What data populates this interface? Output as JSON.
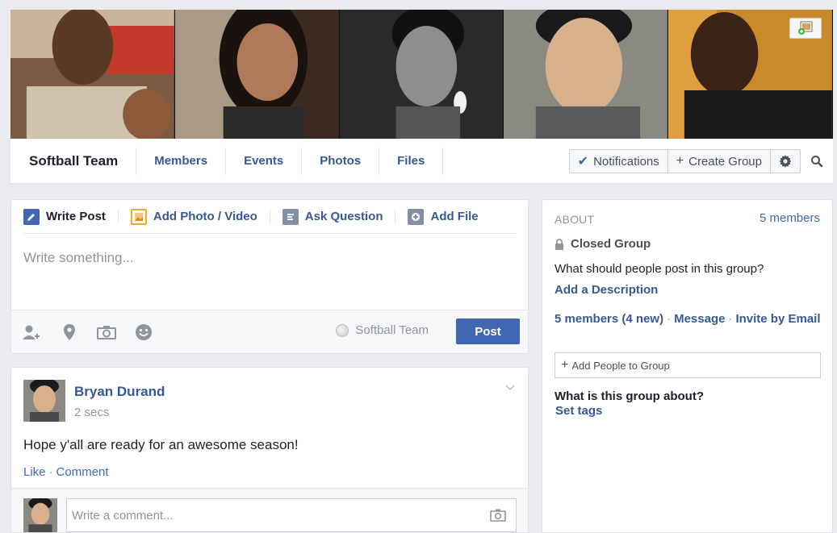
{
  "group": {
    "name": "Softball Team",
    "nav_links": [
      "Members",
      "Events",
      "Photos",
      "Files"
    ],
    "notifications_label": "Notifications",
    "create_group_label": "Create Group"
  },
  "composer": {
    "tabs": [
      {
        "label": "Write Post",
        "icon": "pencil-icon",
        "color": "#4267b2"
      },
      {
        "label": "Add Photo / Video",
        "icon": "photo-icon",
        "color": "#f5a623"
      },
      {
        "label": "Ask Question",
        "icon": "question-icon",
        "color": "#7f8fa6"
      },
      {
        "label": "Add File",
        "icon": "file-icon",
        "color": "#7f8fa6"
      }
    ],
    "placeholder": "Write something...",
    "footer_icons": [
      "tag-friends-icon",
      "location-icon",
      "camera-icon",
      "feeling-icon"
    ],
    "audience": "Softball Team",
    "post_label": "Post"
  },
  "story": {
    "author": "Bryan Durand",
    "time": "2 secs",
    "text": "Hope y'all are ready for an awesome season!",
    "like_label": "Like",
    "comment_label": "Comment",
    "comment_placeholder": "Write a comment..."
  },
  "about": {
    "title": "ABOUT",
    "member_count": "5 members",
    "privacy": "Closed Group",
    "description_prompt": "What should people post in this group?",
    "add_description": "Add a Description",
    "members_link": "5 members",
    "members_new": "(4 new)",
    "message_link": "Message",
    "invite_link": "Invite by Email",
    "add_people_placeholder": "Add People to Group",
    "about_question": "What is this group about?",
    "set_tags": "Set tags"
  },
  "colors": {
    "brand_blue": "#4267b2",
    "link_blue": "#365899",
    "background": "#e9ebee"
  }
}
